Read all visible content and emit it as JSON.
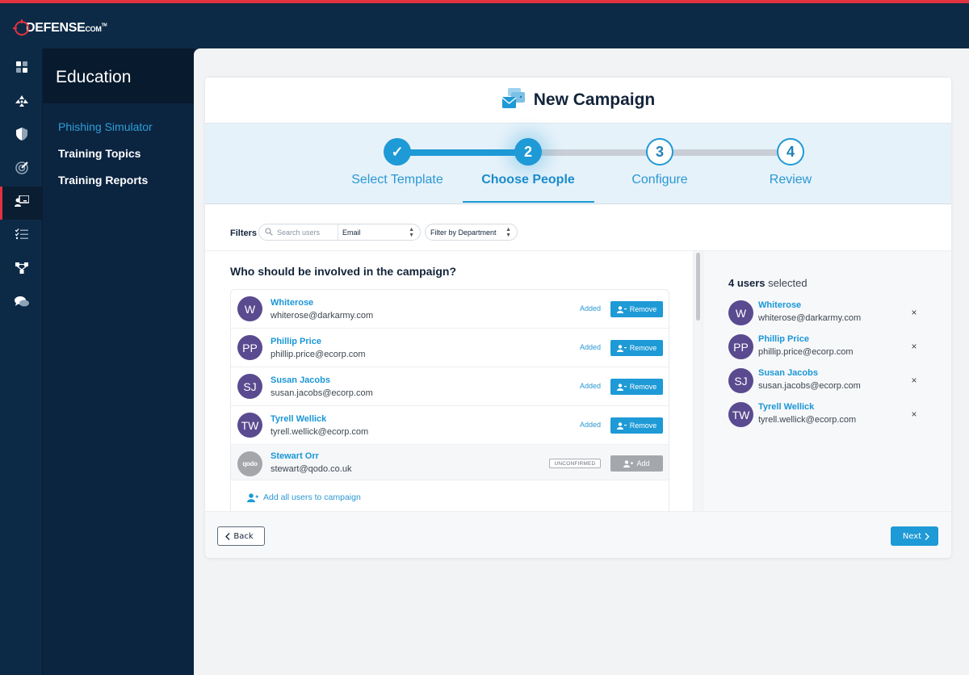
{
  "brand": {
    "name": "DEFENSE",
    "suffix": "COM",
    "tm": "TM",
    "accent": "#e0323f"
  },
  "rail": {
    "items": [
      {
        "icon": "dashboard-grid-icon",
        "active": false
      },
      {
        "icon": "radiation-icon",
        "active": false
      },
      {
        "icon": "shield-icon",
        "active": false
      },
      {
        "icon": "radar-icon",
        "active": false
      },
      {
        "icon": "education-presenter-icon",
        "active": true
      },
      {
        "icon": "checklist-icon",
        "active": false
      },
      {
        "icon": "network-nodes-icon",
        "active": false
      },
      {
        "icon": "chat-bubbles-icon",
        "active": false
      }
    ]
  },
  "subnav": {
    "title": "Education",
    "items": [
      {
        "label": "Phishing Simulator",
        "active": true
      },
      {
        "label": "Training Topics",
        "active": false
      },
      {
        "label": "Training Reports",
        "active": false
      }
    ]
  },
  "page": {
    "title": "New Campaign",
    "icon": "campaign-envelope-icon"
  },
  "stepper": {
    "steps": [
      {
        "number": "✓",
        "label": "Select Template",
        "state": "done"
      },
      {
        "number": "2",
        "label": "Choose People",
        "state": "active"
      },
      {
        "number": "3",
        "label": "Configure",
        "state": "todo"
      },
      {
        "number": "4",
        "label": "Review",
        "state": "todo"
      }
    ]
  },
  "filters": {
    "label": "Filters",
    "search_placeholder": "Search users",
    "field_select": "Email",
    "department_select": "Filter by Department"
  },
  "people": {
    "question": "Who should be involved in the campaign?",
    "users": [
      {
        "initials": "W",
        "name": "Whiterose",
        "email": "whiterose@darkarmy.com",
        "status": "Added",
        "action": "Remove"
      },
      {
        "initials": "PP",
        "name": "Phillip Price",
        "email": "phillip.price@ecorp.com",
        "status": "Added",
        "action": "Remove"
      },
      {
        "initials": "SJ",
        "name": "Susan Jacobs",
        "email": "susan.jacobs@ecorp.com",
        "status": "Added",
        "action": "Remove"
      },
      {
        "initials": "TW",
        "name": "Tyrell Wellick",
        "email": "tyrell.wellick@ecorp.com",
        "status": "Added",
        "action": "Remove"
      },
      {
        "initials": "qodo",
        "name": "Stewart Orr",
        "email": "stewart@qodo.co.uk",
        "status": "UNCONFIRMED",
        "action": "Add"
      }
    ],
    "add_all_label": "Add all users to campaign"
  },
  "selected": {
    "count": "4 users",
    "suffix": " selected",
    "users": [
      {
        "initials": "W",
        "name": "Whiterose",
        "email": "whiterose@darkarmy.com"
      },
      {
        "initials": "PP",
        "name": "Phillip Price",
        "email": "phillip.price@ecorp.com"
      },
      {
        "initials": "SJ",
        "name": "Susan Jacobs",
        "email": "susan.jacobs@ecorp.com"
      },
      {
        "initials": "TW",
        "name": "Tyrell Wellick",
        "email": "tyrell.wellick@ecorp.com"
      }
    ],
    "remove_glyph": "×"
  },
  "footer": {
    "back_label": "Back",
    "next_label": "Next"
  }
}
